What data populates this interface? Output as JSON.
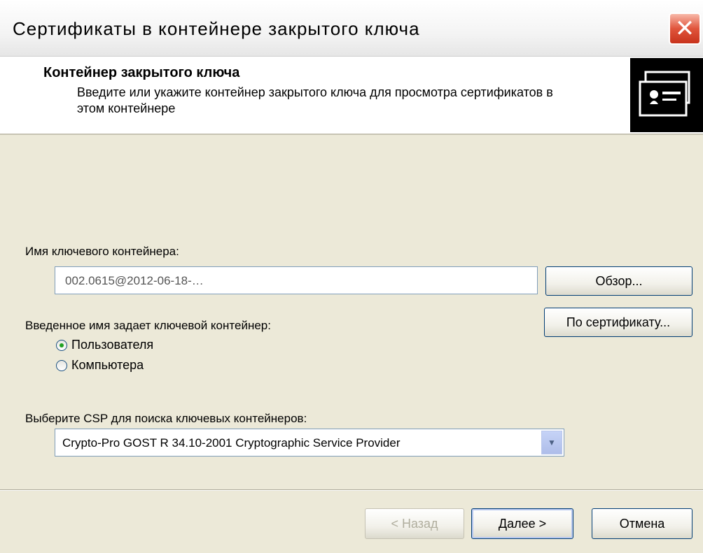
{
  "window": {
    "title": "Сертификаты в контейнере закрытого ключа"
  },
  "header": {
    "title": "Контейнер закрытого ключа",
    "description": "Введите или укажите контейнер закрытого ключа для просмотра сертификатов в этом контейнере",
    "icon": "certificate-icon"
  },
  "container": {
    "label": "Имя ключевого контейнера:",
    "value": "002.0615@2012-06-18-…",
    "browse_button": "Обзор...",
    "by_cert_button": "По сертификату..."
  },
  "scope": {
    "label": "Введенное имя задает ключевой контейнер:",
    "options": [
      {
        "label": "Пользователя",
        "selected": true
      },
      {
        "label": "Компьютера",
        "selected": false
      }
    ]
  },
  "csp": {
    "label": "Выберите CSP для поиска ключевых контейнеров:",
    "selected": "Crypto-Pro GOST R 34.10-2001 Cryptographic Service Provider"
  },
  "footer": {
    "back_button": "< Назад",
    "next_button": "Далее >",
    "cancel_button": "Отмена"
  }
}
